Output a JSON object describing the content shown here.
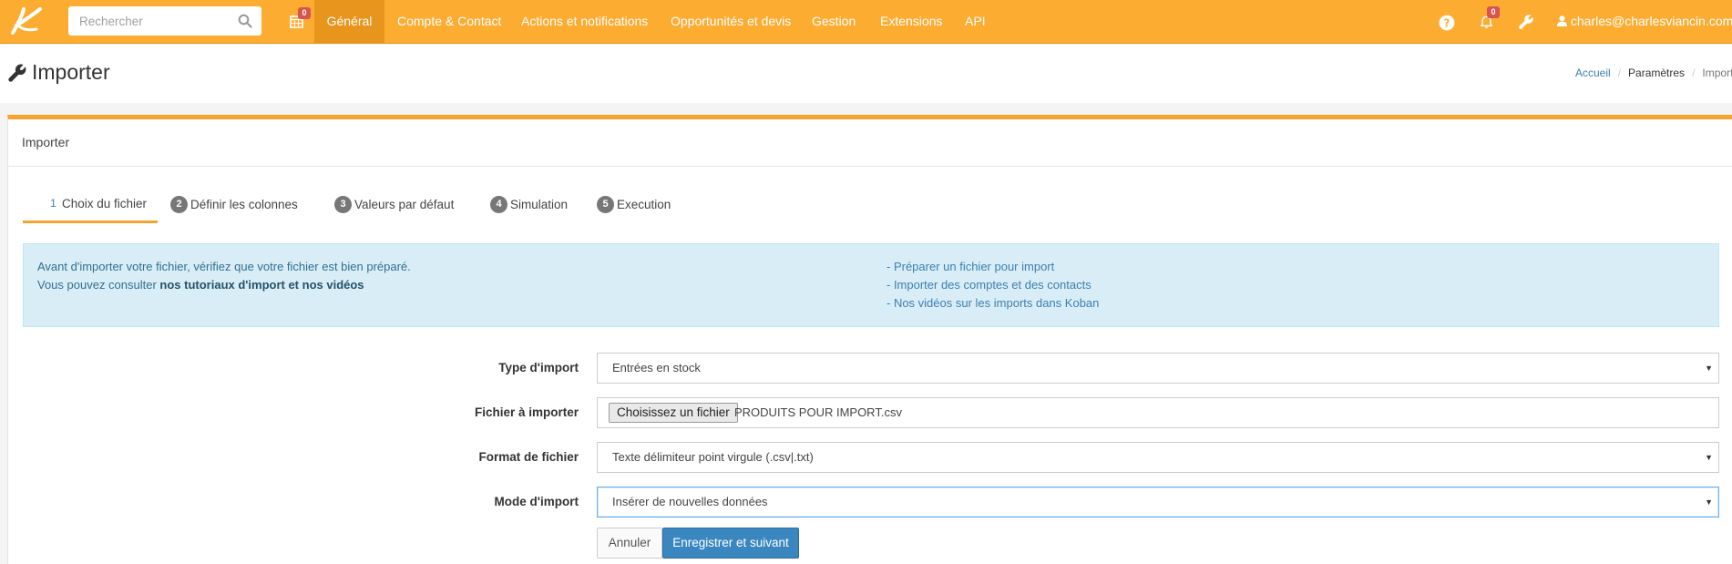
{
  "search": {
    "placeholder": "Rechercher"
  },
  "calendar_badge": "0",
  "nav": [
    {
      "label": "Général"
    },
    {
      "label": "Compte & Contact"
    },
    {
      "label": "Actions et notifications"
    },
    {
      "label": "Opportunités et devis"
    },
    {
      "label": "Gestion"
    },
    {
      "label": "Extensions"
    },
    {
      "label": "API"
    }
  ],
  "notifications_badge": "0",
  "user": {
    "email": "charles@charlesviancin.com"
  },
  "page": {
    "title": "Importer"
  },
  "breadcrumb": [
    "Accueil",
    "Paramètres",
    "Importer"
  ],
  "panel": {
    "title": "Importer"
  },
  "steps": [
    {
      "num": "1",
      "label": "Choix du fichier"
    },
    {
      "num": "2",
      "label": "Définir les colonnes"
    },
    {
      "num": "3",
      "label": "Valeurs par défaut"
    },
    {
      "num": "4",
      "label": "Simulation"
    },
    {
      "num": "5",
      "label": "Execution"
    }
  ],
  "info": {
    "line1": "Avant d'importer votre fichier, vérifiez que votre fichier est bien préparé.",
    "line2_prefix": "Vous pouvez consulter ",
    "line2_bold": "nos tutoriaux d'import et nos vidéos",
    "links": [
      "- Préparer un fichier pour import",
      "- Importer des comptes et des contacts",
      "- Nos vidéos sur les imports dans Koban"
    ]
  },
  "form": {
    "type_label": "Type d'import",
    "type_value": "Entrées en stock",
    "file_label": "Fichier à importer",
    "file_button": "Choisissez un fichier",
    "file_name": "PRODUITS POUR IMPORT.csv",
    "format_label": "Format de fichier",
    "format_value": "Texte délimiteur point virgule (.csv|.txt)",
    "mode_label": "Mode d'import",
    "mode_value": "Insérer de nouvelles données"
  },
  "buttons": {
    "cancel": "Annuler",
    "save": "Enregistrer et suivant"
  },
  "colors": {
    "accent": "#fdac32",
    "active_nav": "#e8951d",
    "primary": "#3a87c0",
    "info_bg": "#d9edf7"
  }
}
